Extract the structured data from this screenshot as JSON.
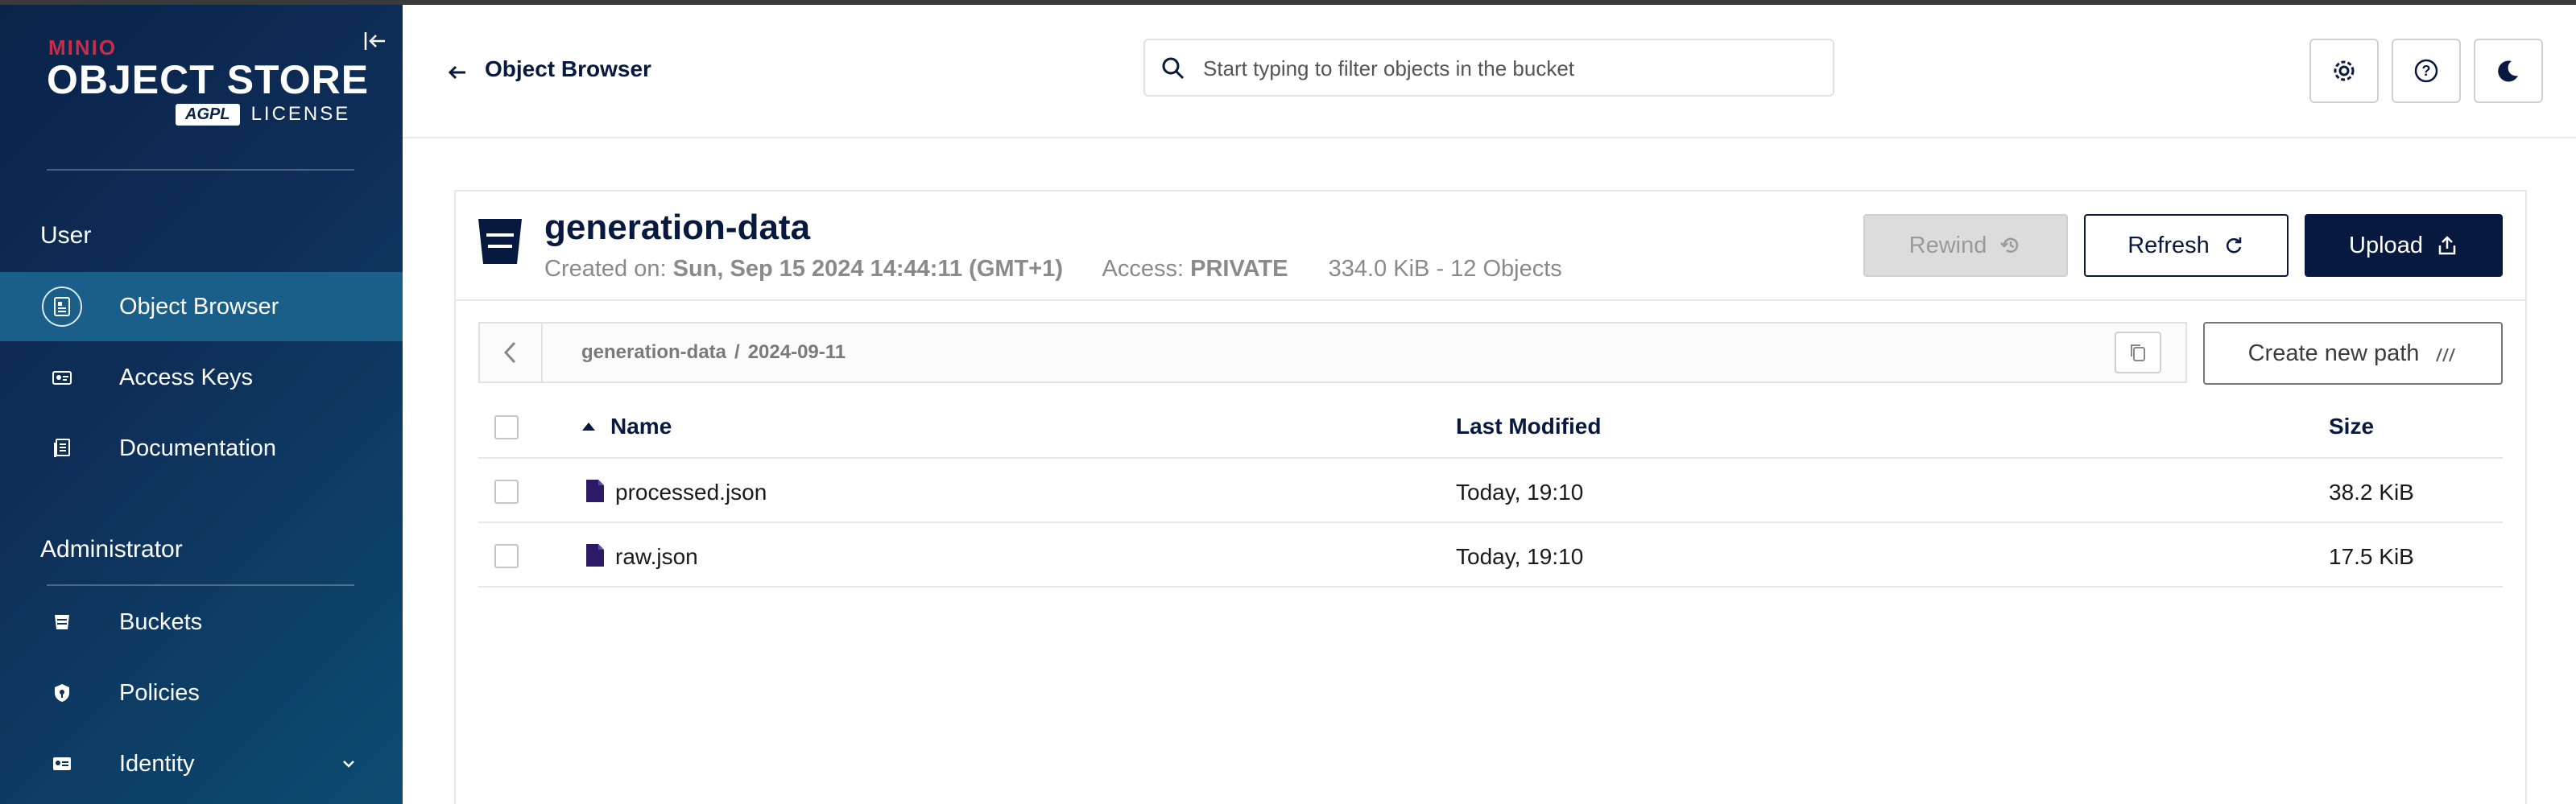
{
  "sidebar": {
    "brand_top": "MINIO",
    "brand_main": "OBJECT STORE",
    "brand_badge": "AGPL",
    "brand_license": "LICENSE",
    "user_section": "User",
    "user_items": [
      {
        "label": "Object Browser",
        "icon": "object-browser-icon",
        "active": true
      },
      {
        "label": "Access Keys",
        "icon": "access-keys-icon",
        "active": false
      },
      {
        "label": "Documentation",
        "icon": "documentation-icon",
        "active": false
      }
    ],
    "admin_section": "Administrator",
    "admin_items": [
      {
        "label": "Buckets",
        "icon": "bucket-icon"
      },
      {
        "label": "Policies",
        "icon": "policy-shield-icon"
      },
      {
        "label": "Identity",
        "icon": "identity-card-icon"
      }
    ]
  },
  "header": {
    "title": "Object Browser",
    "search_placeholder": "Start typing to filter objects in the bucket"
  },
  "bucket": {
    "name": "generation-data",
    "created_label": "Created on:",
    "created_value": "Sun, Sep 15 2024 14:44:11 (GMT+1)",
    "access_label": "Access:",
    "access_value": "PRIVATE",
    "summary": "334.0 KiB - 12 Objects"
  },
  "actions": {
    "rewind": "Rewind",
    "refresh": "Refresh",
    "upload": "Upload",
    "create_path": "Create new path"
  },
  "path": {
    "bucket": "generation-data",
    "separator": "/",
    "folder": "2024-09-11"
  },
  "table": {
    "columns": {
      "name": "Name",
      "modified": "Last Modified",
      "size": "Size"
    },
    "rows": [
      {
        "name": "processed.json",
        "modified": "Today, 19:10",
        "size": "38.2 KiB"
      },
      {
        "name": "raw.json",
        "modified": "Today, 19:10",
        "size": "17.5 KiB"
      }
    ]
  },
  "colors": {
    "navy": "#07193e",
    "sidebar_active": "#1a5e8a",
    "brand_red": "#c72c48",
    "file_icon": "#2d1a66"
  }
}
